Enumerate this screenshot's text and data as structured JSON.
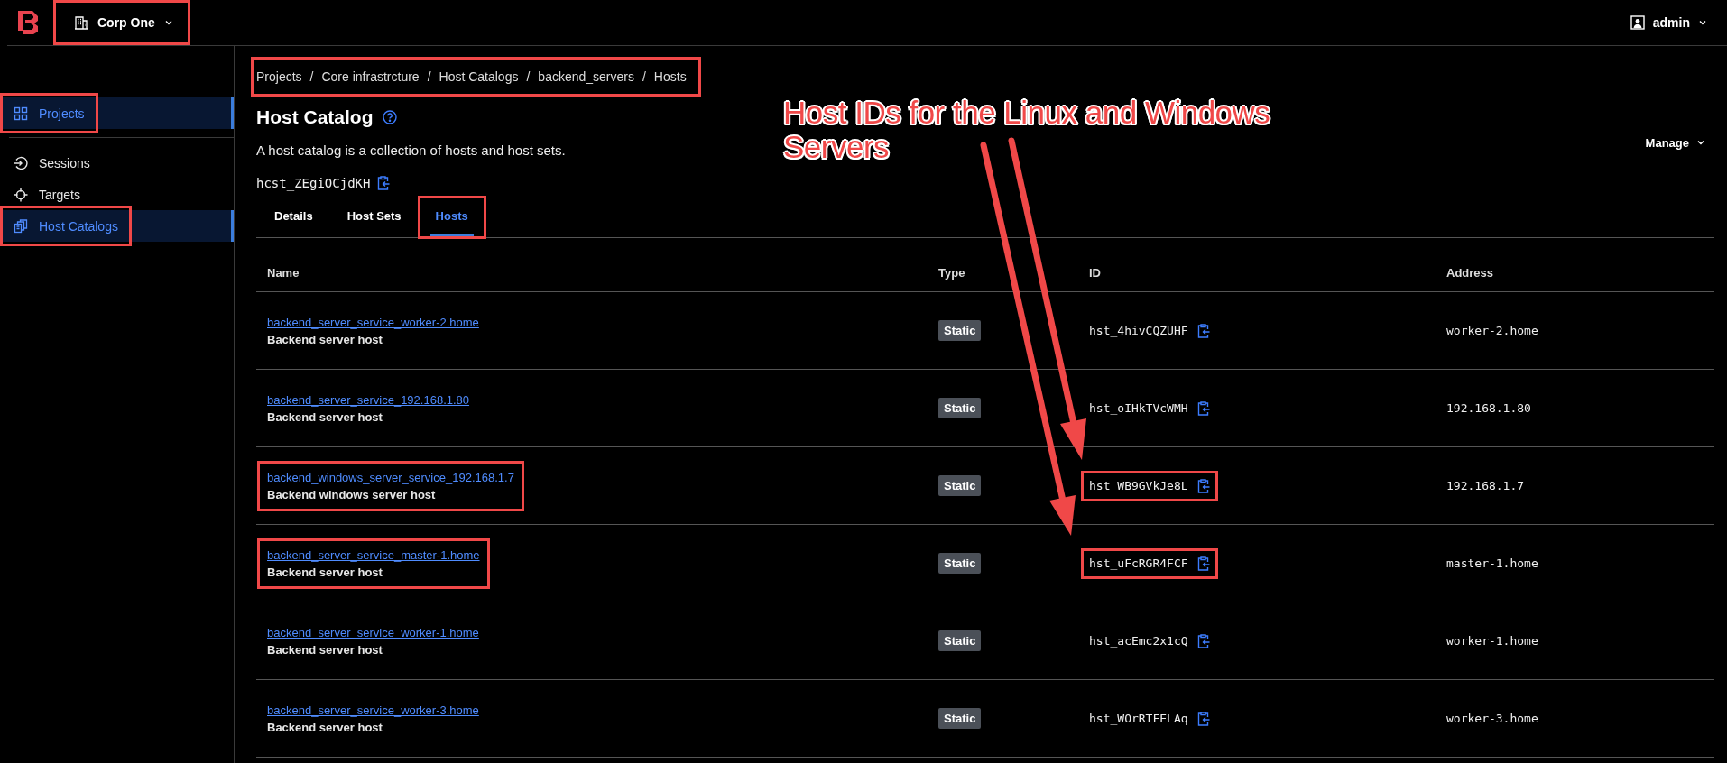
{
  "header": {
    "org": {
      "name": "Corp One",
      "highlighted": true
    },
    "user": "admin"
  },
  "sidebar": {
    "sections": [
      {
        "items": [
          {
            "label": "Projects",
            "kind": "projects",
            "selected": true,
            "highlighted": true
          }
        ]
      },
      {
        "items": [
          {
            "label": "Sessions",
            "kind": "sessions",
            "selected": false,
            "highlighted": false
          },
          {
            "label": "Targets",
            "kind": "targets",
            "selected": false,
            "highlighted": false
          },
          {
            "label": "Host Catalogs",
            "kind": "catalogs",
            "selected": true,
            "highlighted": true
          }
        ]
      }
    ]
  },
  "breadcrumb": {
    "highlighted": true,
    "separator": "/",
    "items": [
      "Projects",
      "Core infrastrcture",
      "Host Catalogs",
      "backend_servers",
      "Hosts"
    ]
  },
  "title": "Host Catalog",
  "description": "A host catalog is a collection of hosts and host sets.",
  "catalog_id": "hcst_ZEgiOCjdKH",
  "manage": "Manage",
  "tabs": [
    {
      "label": "Details",
      "selected": false,
      "highlighted": false
    },
    {
      "label": "Host Sets",
      "selected": false,
      "highlighted": false
    },
    {
      "label": "Hosts",
      "selected": true,
      "highlighted": true
    }
  ],
  "table": {
    "columns": [
      "Name",
      "Type",
      "ID",
      "Address"
    ],
    "rows": [
      {
        "name": "backend_server_service_worker-2.home",
        "description": "Backend server host",
        "type": "Static",
        "id": "hst_4hivCQZUHF",
        "address": "worker-2.home",
        "highlighted": false
      },
      {
        "name": "backend_server_service_192.168.1.80",
        "description": "Backend server host",
        "type": "Static",
        "id": "hst_oIHkTVcWMH",
        "address": "192.168.1.80",
        "highlighted": false
      },
      {
        "name": "backend_windows_server_service_192.168.1.7",
        "description": "Backend windows server host",
        "type": "Static",
        "id": "hst_WB9GVkJe8L",
        "address": "192.168.1.7",
        "highlighted": true
      },
      {
        "name": "backend_server_service_master-1.home",
        "description": "Backend server host",
        "type": "Static",
        "id": "hst_uFcRGR4FCF",
        "address": "master-1.home",
        "highlighted": true
      },
      {
        "name": "backend_server_service_worker-1.home",
        "description": "Backend server host",
        "type": "Static",
        "id": "hst_acEmc2x1cQ",
        "address": "worker-1.home",
        "highlighted": false
      },
      {
        "name": "backend_server_service_worker-3.home",
        "description": "Backend server host",
        "type": "Static",
        "id": "hst_WOrRTFELAq",
        "address": "worker-3.home",
        "highlighted": false
      }
    ]
  },
  "annotation": {
    "text": "Host IDs for the Linux and Windows Servers"
  }
}
